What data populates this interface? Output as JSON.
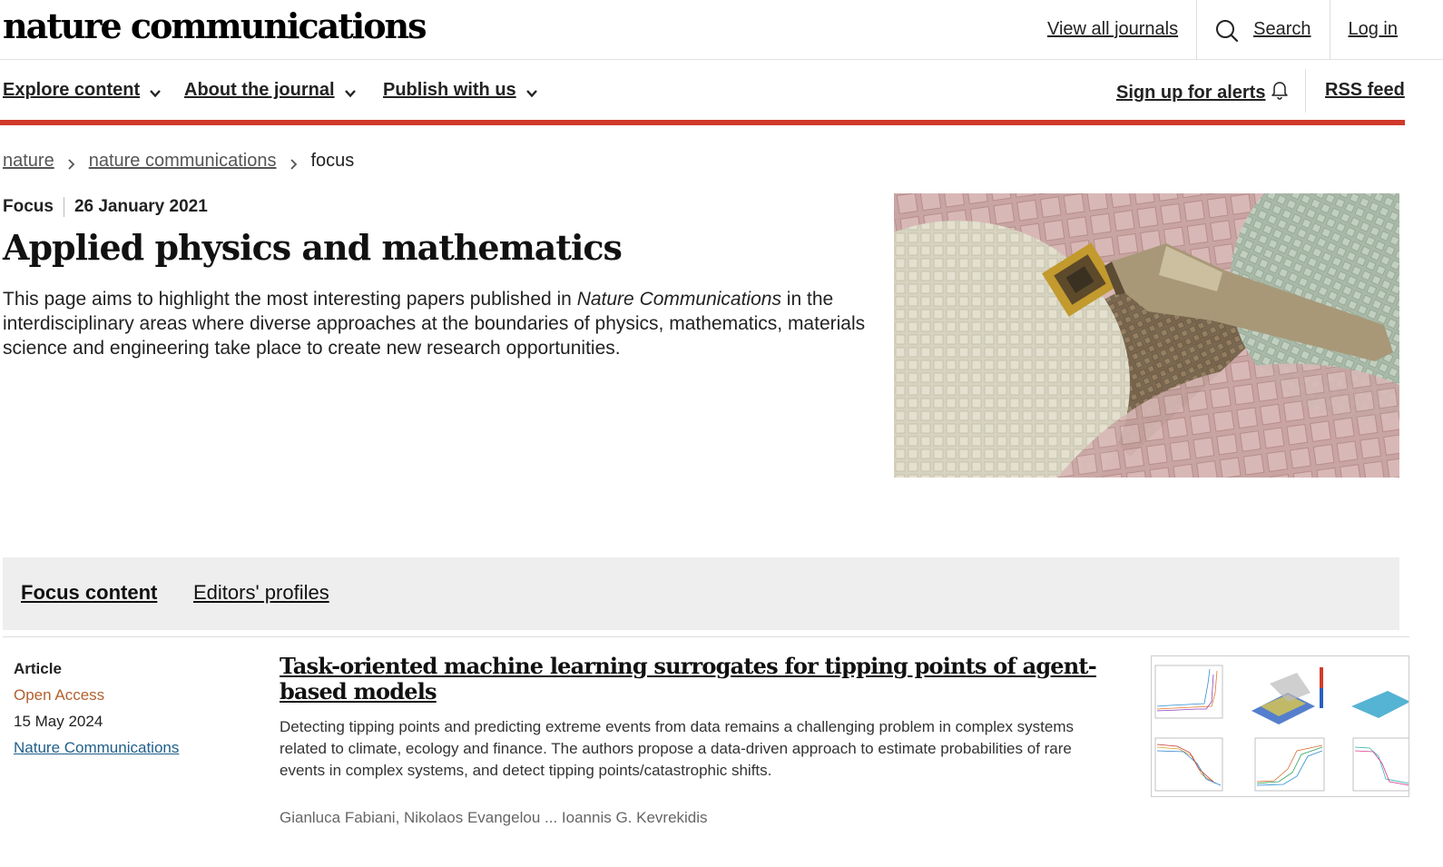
{
  "header": {
    "logo": "nature communications",
    "view_all_journals": "View all journals",
    "search_label": "Search",
    "login_label": "Log in"
  },
  "mainnav": {
    "explore": "Explore content",
    "about": "About the journal",
    "publish": "Publish with us",
    "alerts": "Sign up for alerts",
    "rss": "RSS feed"
  },
  "breadcrumb": {
    "items": [
      "nature",
      "nature communications",
      "focus"
    ]
  },
  "focus": {
    "type": "Focus",
    "date": "26 January 2021",
    "title": "Applied physics and mathematics",
    "intro_before": "This page aims to highlight the most interesting papers published in ",
    "intro_em": "Nature Communications",
    "intro_after": " in the interdisciplinary areas where diverse approaches at the boundaries of physics, mathematics, materials science and engineering take place to create new research opportunities."
  },
  "tabs": {
    "focus_content": "Focus content",
    "editors_profiles": "Editors' profiles"
  },
  "article": {
    "type": "Article",
    "access": "Open Access",
    "date": "15 May 2024",
    "journal": "Nature Communications",
    "title": "Task-oriented machine learning surrogates for tipping points of agent-based models",
    "description": "Detecting tipping points and predicting extreme events from data remains a challenging problem in complex systems related to climate, ecology and finance. The authors propose a data-driven approach to estimate probabilities of rare events in complex systems, and detect tipping points/catastrophic shifts.",
    "authors": "Gianluca Fabiani, Nikolaos Evangelou ... Ioannis G. Kevrekidis"
  },
  "colors": {
    "accent_red": "#d03a2b",
    "open_access": "#b3602c",
    "journal_link": "#1f5f8b",
    "tabs_background": "#eeeeee"
  },
  "icons": {
    "search": "search-icon",
    "chevron": "chevron-down-icon",
    "bell": "bell-icon",
    "breadcrumb_separator": "chevron-right-icon"
  }
}
